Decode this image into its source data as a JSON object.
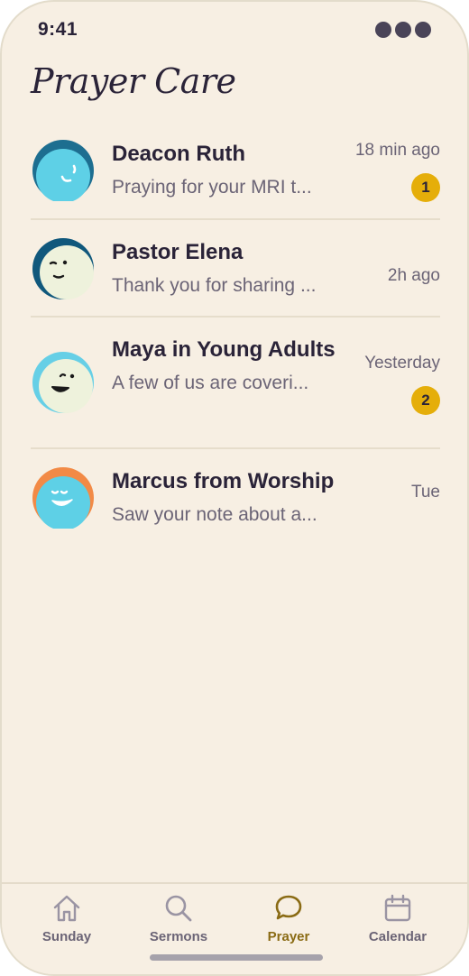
{
  "status_bar": {
    "time": "9:41"
  },
  "header": {
    "title": "Prayer Care"
  },
  "conversations": [
    {
      "name": "Deacon Ruth",
      "preview": "Praying for your MRI t...",
      "time": "18 min ago",
      "unread": "1",
      "avatar_icon": "smiling-face-icon",
      "avatar_colors": {
        "ring": "#1d6e90",
        "face": "#5ed0e6"
      }
    },
    {
      "name": "Pastor Elena",
      "preview": "Thank you for sharing ...",
      "time": "2h ago",
      "unread": "",
      "avatar_icon": "winking-face-icon",
      "avatar_colors": {
        "ring": "#10587c",
        "face": "#eef2dc"
      }
    },
    {
      "name": "Maya in Young Adults",
      "preview": "A few of us are coveri...",
      "time": "Yesterday",
      "unread": "2",
      "avatar_icon": "grinning-face-icon",
      "avatar_colors": {
        "ring": "#66cfe6",
        "face": "#eef2dc"
      }
    },
    {
      "name": "Marcus from Worship",
      "preview": "Saw your note about a...",
      "time": "Tue",
      "unread": "",
      "avatar_icon": "happy-face-icon",
      "avatar_colors": {
        "ring": "#f28a46",
        "face": "#5ed0e6"
      }
    }
  ],
  "tab_bar": {
    "tabs": [
      {
        "label": "Sunday",
        "icon": "home-icon",
        "active": false
      },
      {
        "label": "Sermons",
        "icon": "search-icon",
        "active": false
      },
      {
        "label": "Prayer",
        "icon": "chat-bubble-icon",
        "active": true
      },
      {
        "label": "Calendar",
        "icon": "calendar-icon",
        "active": false
      }
    ]
  },
  "colors": {
    "background": "#f7efe3",
    "text": "#2a2338",
    "muted_text": "#6b6476",
    "badge": "#e5ae0a",
    "active_tab": "#8a6b14",
    "divider": "#e6ddcb"
  }
}
